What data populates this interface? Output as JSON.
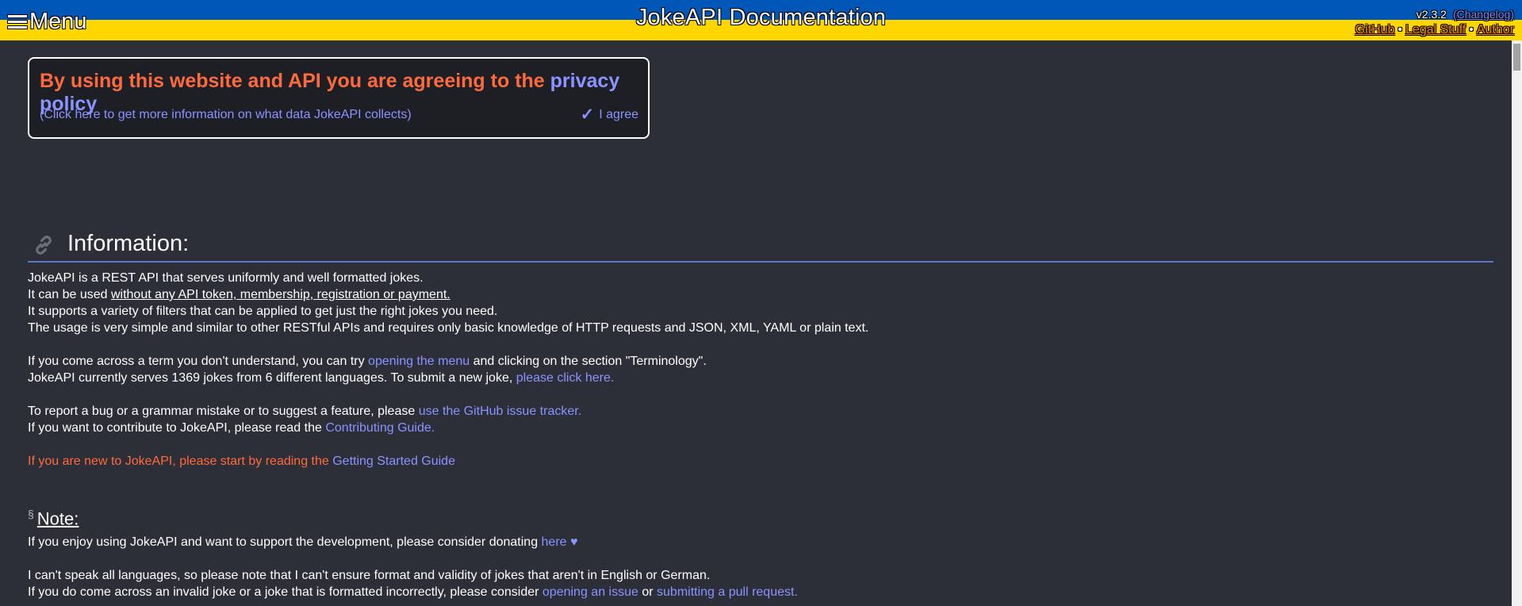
{
  "header": {
    "menu_label": "Menu",
    "title": "JokeAPI Documentation",
    "version": "v2.3.2",
    "changelog_label": "(Changelog)",
    "links": [
      "GitHub",
      "Legal Stuff",
      "Author"
    ],
    "separator": "•",
    "colors": {
      "top_band": "#0057b7",
      "bottom_band": "#ffd700"
    }
  },
  "privacy": {
    "text": "By using this website and API you are agreeing to the",
    "link": "privacy policy",
    "info": "(Click here to get more information on what data JokeAPI collects)",
    "agree_icon": "✓",
    "agree": "I agree"
  },
  "information": {
    "title": "Information:",
    "line1": "JokeAPI is a REST API that serves uniformly and well formatted jokes.",
    "line2_pre": "It can be used ",
    "line2_u": "without any API token, membership, registration or payment.",
    "line3": "It supports a variety of filters that can be applied to get just the right jokes you need.",
    "line4": "The usage is very simple and similar to other RESTful APIs and requires only basic knowledge of HTTP requests and JSON, XML, YAML or plain text.",
    "line5_pre": "If you come across a term you don't understand, you can try ",
    "line5_link": "opening the menu",
    "line5_post": " and clicking on the section \"Terminology\".",
    "line6_pre": "JokeAPI currently serves 1369 jokes from 6 different languages. To submit a new joke, ",
    "line6_link": "please click here.",
    "line7_pre": "To report a bug or a grammar mistake or to suggest a feature, please ",
    "line7_link": "use the GitHub issue tracker.",
    "line8_pre": "If you want to contribute to JokeAPI, please read the ",
    "line8_link": "Contributing Guide.",
    "line9_pre": "If you are new to JokeAPI, please start by reading the ",
    "line9_link": "Getting Started Guide"
  },
  "note": {
    "icon": "§",
    "title": "Note:",
    "line1_pre": "If you enjoy using JokeAPI and want to support the development, please consider donating ",
    "line1_link": "here ♥",
    "line2": "I can't speak all languages, so please note that I can't ensure format and validity of jokes that aren't in English or German.",
    "line3_pre": "If you do come across an invalid joke or a joke that is formatted incorrectly, please consider ",
    "line3_link1": "opening an issue",
    "line3_mid": " or ",
    "line3_link2": "submitting a pull request."
  }
}
